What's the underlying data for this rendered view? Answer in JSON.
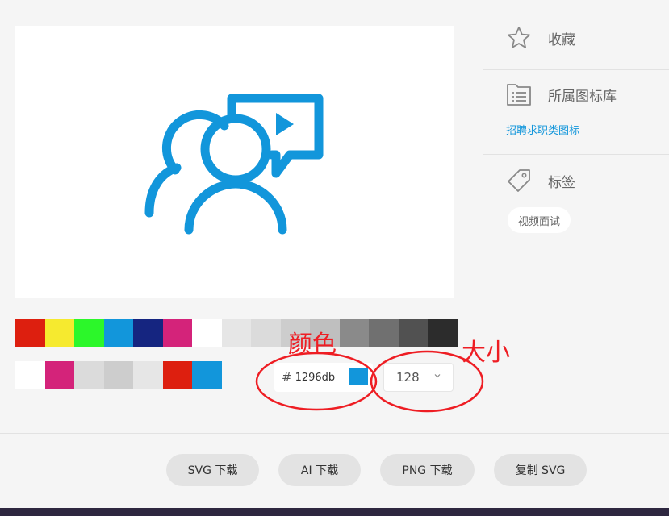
{
  "preview": {
    "icon": "video-interview-icon",
    "color": "#1296db"
  },
  "palette": {
    "row1": [
      "#dd1f0f",
      "#f6ea2f",
      "#2cf72a",
      "#1296db",
      "#152580",
      "#d4237a",
      "#ffffff",
      "#e6e6e6",
      "#dbdbdb",
      "#cdcdcd",
      "#bfbfbf",
      "#8a8a8a",
      "#707070",
      "#515151",
      "#2c2c2c"
    ],
    "row2": [
      "#ffffff",
      "#d4237a",
      "#dbdbdb",
      "#cdcdcd",
      "#e6e6e6",
      "#dd1f0f",
      "#1296db"
    ]
  },
  "color_input": {
    "hash": "#",
    "value": "1296db",
    "chip_color": "#1296db"
  },
  "size_select": {
    "value": "128"
  },
  "annotations": {
    "color_label": "颜色",
    "size_label": "大小"
  },
  "sidebar": {
    "favorite_label": "收藏",
    "library_label": "所属图标库",
    "library_link": "招聘求职类图标",
    "tags_label": "标签",
    "tag": "视频面试"
  },
  "actions": {
    "svg_download": "SVG 下载",
    "ai_download": "AI 下载",
    "png_download": "PNG 下载",
    "copy_svg": "复制 SVG"
  }
}
